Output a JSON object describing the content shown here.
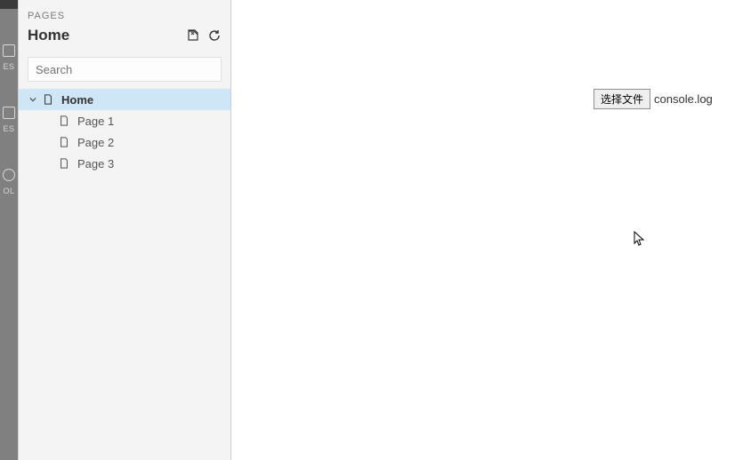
{
  "toolstrip": {
    "items": [
      {
        "label": "ES"
      },
      {
        "label": "ES"
      },
      {
        "label": "OL"
      }
    ]
  },
  "sidebar": {
    "panel_label": "PAGES",
    "title": "Home",
    "search_placeholder": "Search"
  },
  "tree": {
    "root": {
      "label": "Home"
    },
    "children": [
      {
        "label": "Page 1"
      },
      {
        "label": "Page 2"
      },
      {
        "label": "Page 3"
      }
    ]
  },
  "file_input": {
    "button_label": "选择文件",
    "file_name": "console.log"
  }
}
